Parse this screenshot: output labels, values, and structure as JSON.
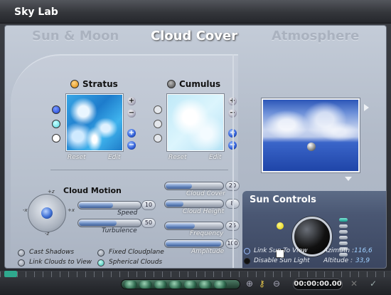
{
  "window": {
    "title": "Sky Lab"
  },
  "tabs": [
    {
      "label": "Sun & Moon",
      "active": false
    },
    {
      "label": "Cloud Cover",
      "active": true
    },
    {
      "label": "Atmosphere",
      "active": false
    }
  ],
  "layers": {
    "stratus": {
      "label": "Stratus",
      "reset": "Reset",
      "edit": "Edit"
    },
    "cumulus": {
      "label": "Cumulus",
      "reset": "Reset",
      "edit": "Edit"
    }
  },
  "cloud_motion": {
    "title": "Cloud Motion",
    "axes": {
      "plus_z": "+z",
      "minus_z": "-z",
      "plus_x": "+x",
      "minus_x": "-x"
    },
    "speed": {
      "label": "Speed",
      "value": "10",
      "level": 0.55
    },
    "turbulence": {
      "label": "Turbulence",
      "value": "50",
      "level": 0.6
    }
  },
  "cloud_params": {
    "cloud_cover": {
      "label": "Cloud Cover",
      "value": "20",
      "level": 0.45
    },
    "cloud_height": {
      "label": "Cloud Height",
      "value": "8",
      "level": 0.3
    },
    "frequency": {
      "label": "Frequency",
      "value": "25",
      "level": 0.5
    },
    "amplitude": {
      "label": "Amplitude",
      "value": "100",
      "level": 0.95
    }
  },
  "options": {
    "cast_shadows": "Cast Shadows",
    "fixed_cloudplane": "Fixed Cloudplane",
    "link_clouds": "Link Clouds to View",
    "spherical_clouds": "Spherical Clouds"
  },
  "sun": {
    "title": "Sun Controls",
    "link_sun": "Link Sun To View",
    "disable_light": "Disable Sun Light",
    "azimuth_label": "Azimuth :",
    "azimuth_value": "116,6",
    "altitude_label": "Altitude :",
    "altitude_value": "33,9"
  },
  "playback": {
    "time": "00:00:00.00"
  },
  "colors": {
    "accent": "#2d5bd6",
    "panel": "#b7c0cd",
    "sun_panel": "#4a5773"
  }
}
